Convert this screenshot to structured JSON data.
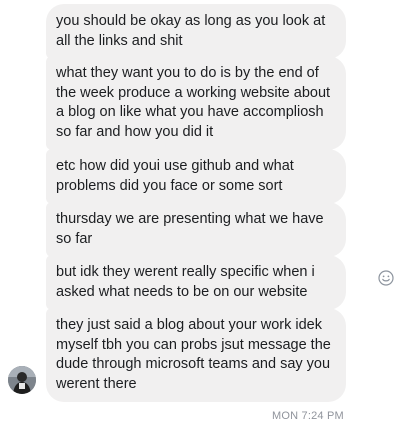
{
  "conversation": {
    "messages": [
      {
        "text": "you should be okay as long as you look at all the links and shit"
      },
      {
        "text": "what they want you to do is by the end of the week produce a working website about a blog on like what you have accompliosh so far and how you did it"
      },
      {
        "text": "etc how did youi use github and what problems did you face or some sort"
      },
      {
        "text": "thursday we are presenting what we have so far"
      },
      {
        "text": "but idk they werent really specific when i asked what needs to be on our website"
      },
      {
        "text": "they just said a blog about your work idek myself tbh you can probs jsut message the dude through microsoft teams and say you werent there"
      }
    ],
    "timestamp": "MON 7:24 PM"
  },
  "icons": {
    "emoji": "smiley-icon",
    "avatar": "user-avatar"
  },
  "colors": {
    "bubble_bg": "#f1f0f0",
    "text": "#1c1e21",
    "timestamp": "#90949c"
  }
}
